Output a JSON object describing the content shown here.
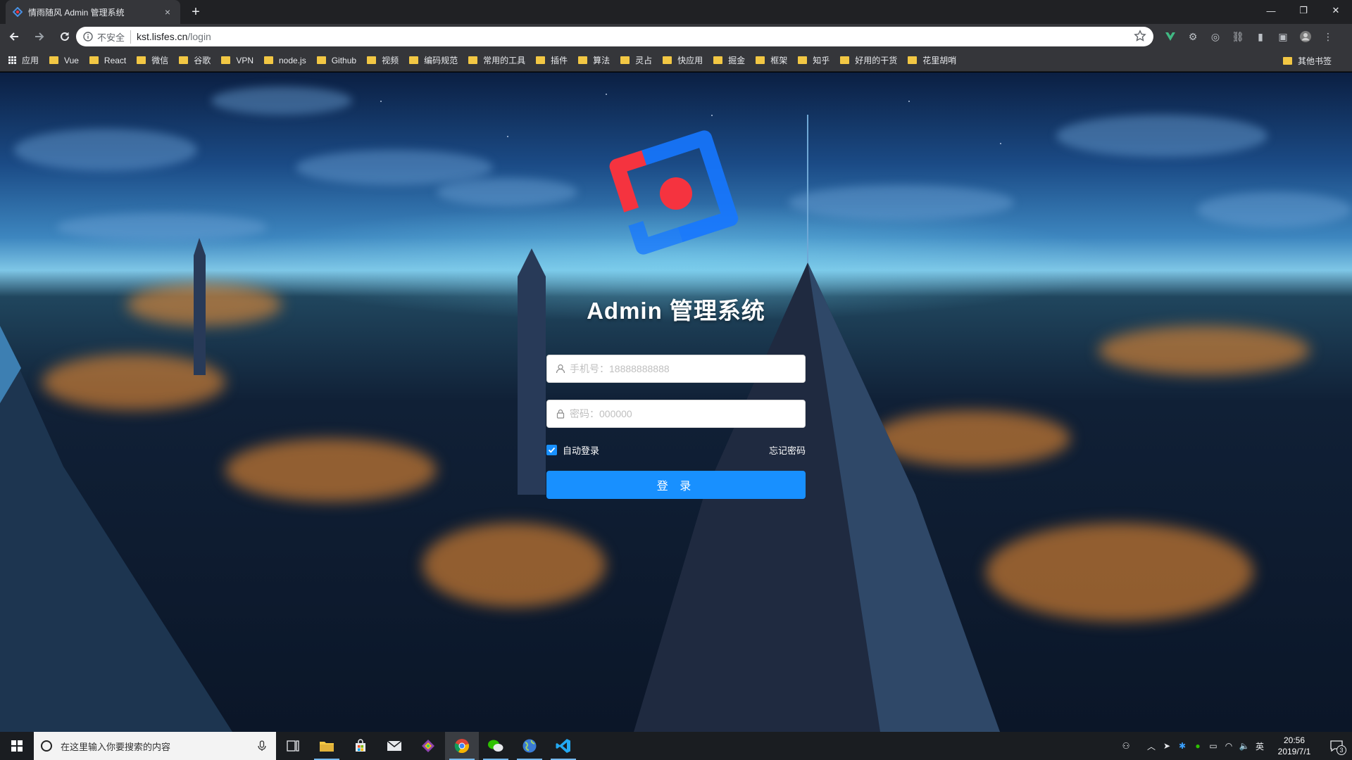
{
  "browser": {
    "tab": {
      "title": "情雨随风 Admin 管理系统",
      "close": "×"
    },
    "new_tab": "+",
    "window_controls": {
      "minimize": "—",
      "restore": "❐",
      "close": "✕"
    },
    "omnibox": {
      "security_label": "不安全",
      "url_host": "kst.lisfes.cn",
      "url_path": "/login"
    },
    "bookmarks": [
      "应用",
      "Vue",
      "React",
      "微信",
      "谷歌",
      "VPN",
      "node.js",
      "Github",
      "视频",
      "编码规范",
      "常用的工具",
      "插件",
      "算法",
      "灵占",
      "快应用",
      "掘金",
      "框架",
      "知乎",
      "好用的干货",
      "花里胡哨"
    ],
    "other_bookmarks": "其他书签"
  },
  "login": {
    "title": "Admin 管理系统",
    "phone_placeholder": "手机号：18888888888",
    "password_placeholder": "密码：000000",
    "remember_label": "自动登录",
    "remember_checked": true,
    "forgot_label": "忘记密码",
    "submit_label": "登 录"
  },
  "taskbar": {
    "search_placeholder": "在这里输入你要搜索的内容",
    "time": "20:56",
    "date": "2019/7/1",
    "ime": "英",
    "notification_count": "3"
  },
  "colors": {
    "primary": "#1890ff",
    "logo_red": "#f5333f",
    "logo_blue": "#1677ff",
    "chrome_dark": "#35363a"
  },
  "icons": [
    "back-icon",
    "forward-icon",
    "reload-icon",
    "info-icon",
    "star-icon",
    "user-icon",
    "lock-icon",
    "check-icon",
    "windows-icon",
    "mic-icon"
  ]
}
